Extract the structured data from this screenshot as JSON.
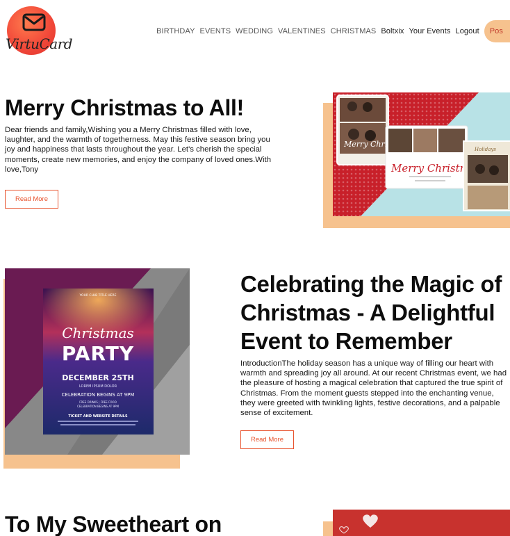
{
  "brand": {
    "name": "VirtuCard"
  },
  "nav": {
    "items": [
      "BIRTHDAY",
      "EVENTS",
      "WEDDING",
      "VALENTINES",
      "CHRISTMAS"
    ],
    "user": "Boltxix",
    "your_events": "Your Events",
    "logout": "Logout",
    "post": "Pos"
  },
  "posts": [
    {
      "title": "Merry Christmas to All!",
      "body": "Dear friends and family,Wishing you a Merry Christmas filled with love, laughter, and the warmth of togetherness. May this festive season bring you joy and happiness that lasts throughout the year. Let's cherish the special moments, create new memories, and enjoy the company of loved ones.With love,Tony",
      "read_more": "Read More",
      "image": {
        "script_text": "Merry Christmas",
        "photo_card_text": "Merry Christmas",
        "small_card_text": "Holidays"
      }
    },
    {
      "title": "Celebrating the Magic of Christmas - A Delightful Event to Remember",
      "body": "IntroductionThe holiday season has a unique way of filling our heart with warmth and spreading joy all around. At our recent Christmas event, we had the pleasure of hosting a magical celebration that captured the true spirit of Christmas. From the moment guests stepped into the enchanting venue, they were greeted with twinkling lights, festive decorations, and a palpable sense of excitement.",
      "read_more": "Read More",
      "image": {
        "top_line": "YOUR CLUB TITLE HERE",
        "script": "Christmas",
        "party": "PARTY",
        "date": "DECEMBER 25TH",
        "lorem": "LOREM IPSUM DOLOR",
        "celebration": "CELEBRATION BEGINS AT 9PM",
        "drinks": "FREE DRINKS  |  FREE FOOD",
        "begins": "CELEBRATION BEGINS AT 9PM",
        "tickets": "TICKET AND WEBSITE DETAILS"
      }
    },
    {
      "title": "To My Sweetheart on"
    }
  ],
  "colors": {
    "accent": "#e8542f",
    "peach": "#f6c28e"
  }
}
